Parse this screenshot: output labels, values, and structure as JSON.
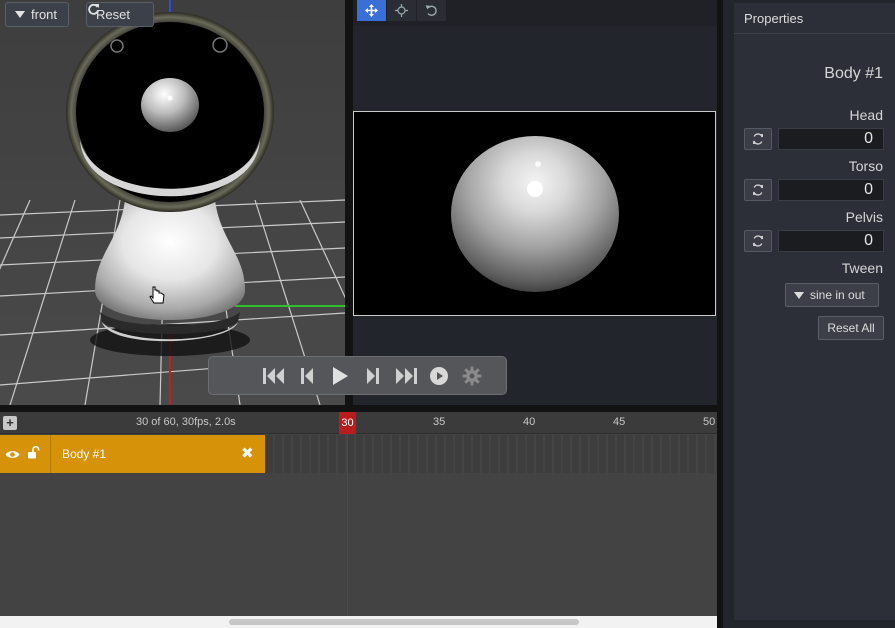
{
  "viewport": {
    "view_label": "front",
    "reset_label": "Reset"
  },
  "camera_toolbar": {
    "tools": [
      "move-icon",
      "target-icon",
      "undo-icon"
    ]
  },
  "playback": {
    "buttons": [
      "jump-start-icon",
      "step-back-icon",
      "play-icon",
      "step-forward-icon",
      "jump-end-icon",
      "loop-icon",
      "gear-icon"
    ]
  },
  "timeline": {
    "frame_info": "30 of 60, 30fps,  2.0s",
    "current_frame": "30",
    "ticks": [
      "35",
      "40",
      "45",
      "50"
    ],
    "track_name": "Body #1",
    "add_label": "+",
    "close_label": "✖"
  },
  "properties": {
    "header": "Properties",
    "title": "Body #1",
    "head_label": "Head",
    "head_value": "0",
    "torso_label": "Torso",
    "torso_value": "0",
    "pelvis_label": "Pelvis",
    "pelvis_value": "0",
    "tween_label": "Tween",
    "tween_value": "sine in out",
    "reset_all_label": "Reset All"
  },
  "colors": {
    "track_accent": "#d69209",
    "playhead": "#b81c1c",
    "tool_active": "#3a6fd8"
  }
}
